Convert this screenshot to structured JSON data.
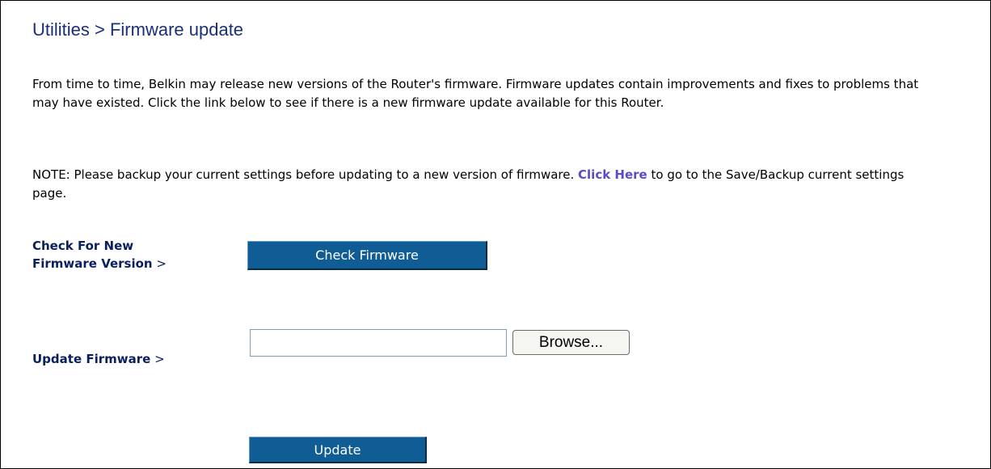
{
  "page": {
    "title": "Utilities > Firmware update"
  },
  "intro": {
    "text": "From time to time, Belkin may release new versions of the Router's firmware. Firmware updates contain improvements and fixes to problems that may have existed. Click the link below to see if there is a new firmware update available for this Router."
  },
  "note": {
    "before": "NOTE: Please backup your current settings before updating to a new version of firmware. ",
    "link_label": "Click Here",
    "after": " to go to the Save/Backup current settings page."
  },
  "check": {
    "label_line1": "Check For New",
    "label_line2": "Firmware Version",
    "arrow": " >",
    "button_label": "Check Firmware"
  },
  "update": {
    "label": "Update Firmware",
    "arrow": " >",
    "file_value": "",
    "browse_label": "Browse...",
    "button_label": "Update"
  },
  "colors": {
    "title": "#1a2f7a",
    "label": "#0a1f5e",
    "link": "#5a4cc8",
    "button": "#0f5d94"
  }
}
